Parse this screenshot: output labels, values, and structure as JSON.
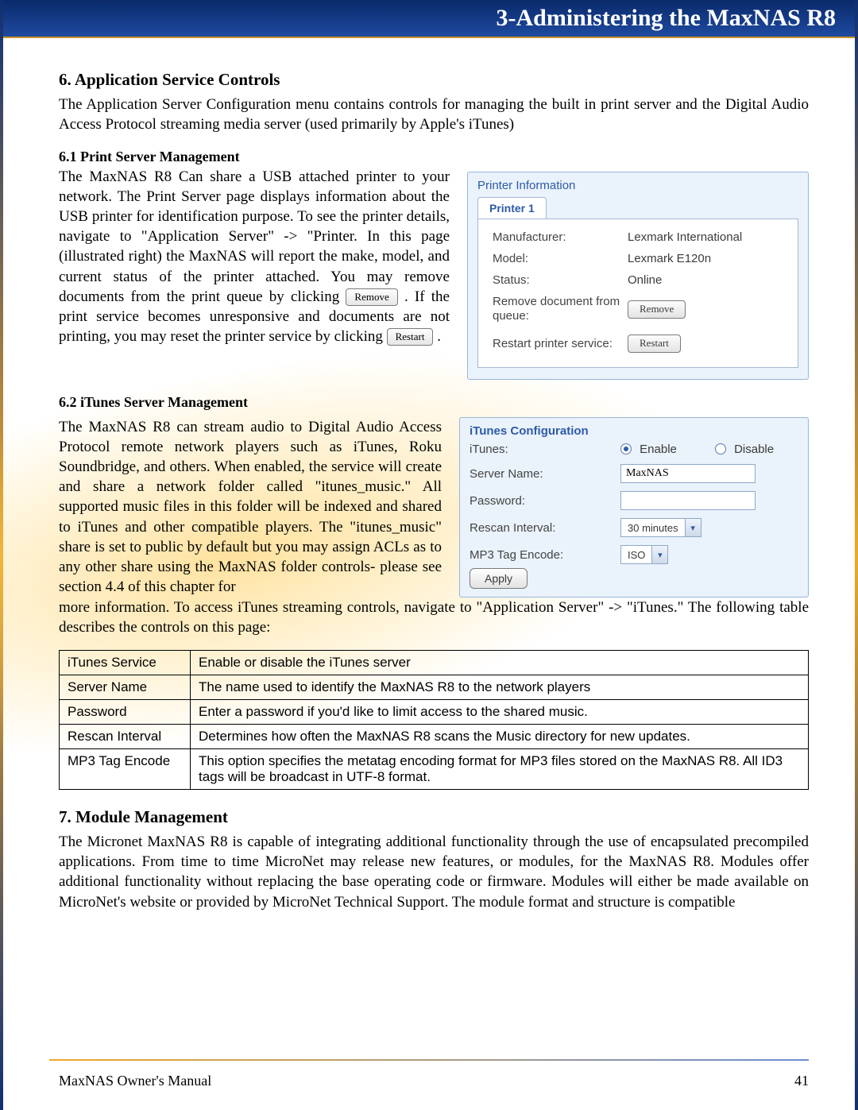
{
  "header": {
    "title": "3-Administering the MaxNAS R8"
  },
  "section6": {
    "title": "6. Application Service Controls",
    "intro": "The Application Server Configuration menu contains controls for managing the built in print server and the Digital Audio Access Protocol streaming media server (used primarily by Apple's iTunes)"
  },
  "s61": {
    "title": "6.1 Print Server Management",
    "p1": "The MaxNAS R8 Can share a USB attached printer to your network. The Print Server page displays information about the USB printer for identification purpose. To see the printer details, navigate to \"Application Server\" -> \"Printer. In this page (illustrated right) the MaxNAS will report the make, model, and current status of the printer attached. You may remove documents from the print queue by clicking ",
    "p2": ". If the print service becomes unresponsive and documents are not printing, you may reset the printer service by clicking ",
    "p3": ".",
    "btn_remove": "Remove",
    "btn_restart": "Restart"
  },
  "printer_panel": {
    "legend": "Printer Information",
    "tab": "Printer 1",
    "rows": {
      "manufacturer_l": "Manufacturer:",
      "manufacturer_v": "Lexmark International",
      "model_l": "Model:",
      "model_v": "Lexmark E120n",
      "status_l": "Status:",
      "status_v": "Online",
      "remove_l": "Remove document from queue:",
      "remove_btn": "Remove",
      "restart_l": "Restart printer service:",
      "restart_btn": "Restart"
    }
  },
  "s62": {
    "title": "6.2 iTunes Server Management",
    "p1": "The MaxNAS R8 can stream audio to Digital Audio Access Protocol remote network players such as iTunes, Roku Soundbridge, and others. When enabled, the service will create and share a network folder called \"itunes_music.\" All supported music files in this folder will be indexed and shared to iTunes and other compatible players. The \"itunes_music\" share is set to public by default but you may assign ACLs as to any other share using the MaxNAS folder controls- please see section 4.4 of this chapter for",
    "p2": "more information. To access iTunes streaming controls, navigate to \"Application Server\" -> \"iTunes.\"  The following table describes the controls on this page:"
  },
  "itunes_panel": {
    "legend": "iTunes Configuration",
    "rows": {
      "itunes_l": "iTunes:",
      "enable": "Enable",
      "disable": "Disable",
      "server_l": "Server Name:",
      "server_v": "MaxNAS",
      "password_l": "Password:",
      "password_v": "",
      "rescan_l": "Rescan Interval:",
      "rescan_v": "30 minutes",
      "encode_l": "MP3 Tag Encode:",
      "encode_v": "ISO",
      "apply": "Apply"
    }
  },
  "table": [
    {
      "k": "iTunes Service",
      "v": "Enable or disable the iTunes server"
    },
    {
      "k": "Server Name",
      "v": "The name used to identify the MaxNAS R8 to the network players"
    },
    {
      "k": "Password",
      "v": "Enter a password if you'd like to limit access to the shared music."
    },
    {
      "k": "Rescan Interval",
      "v": "Determines how often the MaxNAS R8 scans the Music directory for new updates."
    },
    {
      "k": "MP3 Tag Encode",
      "v": "This option specifies the metatag encoding format for MP3 files stored on the MaxNAS R8.  All ID3 tags will be broadcast in UTF-8 format."
    }
  ],
  "section7": {
    "title": "7. Module Management",
    "body": "The Micronet MaxNAS R8 is capable of integrating additional functionality through the use of encapsulated precompiled applications. From time to time MicroNet may release new features, or modules, for the MaxNAS R8.  Modules offer additional functionality without replacing the base operating code or firmware. Modules will either be made available on MicroNet's website or provided by MicroNet Technical Support. The module format and structure is compatible"
  },
  "footer": {
    "left": "MaxNAS Owner's Manual",
    "right": "41"
  }
}
